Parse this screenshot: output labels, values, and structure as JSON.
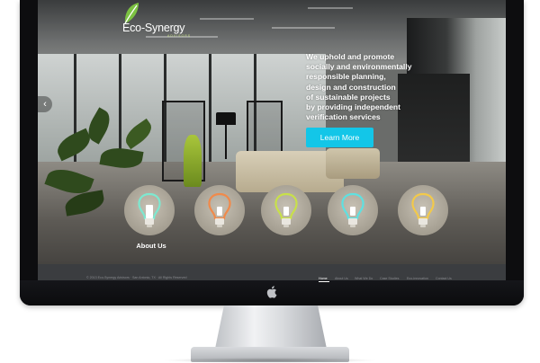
{
  "site": {
    "brand_name": "Eco-Synergy",
    "brand_tagline": "ADVISORS"
  },
  "hero": {
    "lines": [
      "We uphold and promote",
      "socially and environmentally",
      "responsible planning,",
      "design and construction",
      "of sustainable projects",
      "by providing independent",
      "verification services"
    ],
    "cta_label": "Learn More",
    "prev_arrow": "‹"
  },
  "bulbs": [
    {
      "name": "about-us",
      "label": "About Us",
      "color": "#7de8d0"
    },
    {
      "name": "services",
      "label": "",
      "color": "#f08a4b"
    },
    {
      "name": "team",
      "label": "",
      "color": "#c8e04a"
    },
    {
      "name": "clients",
      "label": "",
      "color": "#5fe0e0"
    },
    {
      "name": "contact",
      "label": "",
      "color": "#f2c94a"
    }
  ],
  "footer": {
    "copyright": "© 2013 Eco-Synergy Advisors · San Antonio, TX · All Rights Reserved",
    "nav": [
      "Home",
      "About Us",
      "What We Do",
      "Case Studies",
      "Eco-Innovation",
      "Contact Us"
    ],
    "active": "Home"
  },
  "colors": {
    "accent": "#13c6e8",
    "footer_bg": "#3b3d40",
    "bezel": "#0d0d0f"
  }
}
